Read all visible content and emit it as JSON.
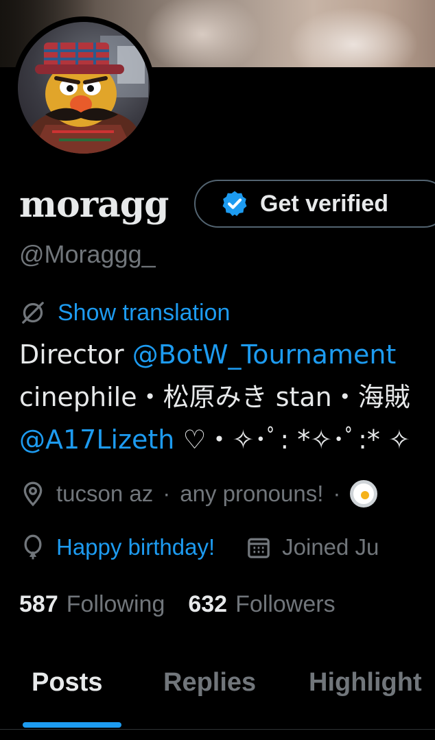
{
  "profile": {
    "display_name": "moragg",
    "handle": "@Moraggg_",
    "verify_label": "Get verified",
    "translation_label": "Show translation"
  },
  "bio": {
    "line1_prefix": "Director ",
    "line1_mention": "@BotW_Tournament",
    "line2": "cinephile・松原みき stan・海賊",
    "line3_mention": "@A17Lizeth",
    "line3_suffix": " ♡・✧･ﾟ: *✧･ﾟ:* ✧"
  },
  "meta": {
    "location": "tucson az",
    "pronouns": "any pronouns!",
    "separator": "·",
    "birthday": "Happy birthday!",
    "joined": "Joined Ju"
  },
  "stats": {
    "following_count": "587",
    "following_label": "Following",
    "followers_count": "632",
    "followers_label": "Followers"
  },
  "tabs": {
    "posts": "Posts",
    "replies": "Replies",
    "highlights": "Highlight"
  },
  "colors": {
    "accent": "#1d9bf0",
    "muted": "#71767b",
    "text": "#e7e9ea",
    "background": "#000000"
  },
  "icons": [
    "verified-check-icon",
    "translate-icon",
    "location-icon",
    "egg-emoji-icon",
    "balloon-icon",
    "calendar-icon"
  ]
}
